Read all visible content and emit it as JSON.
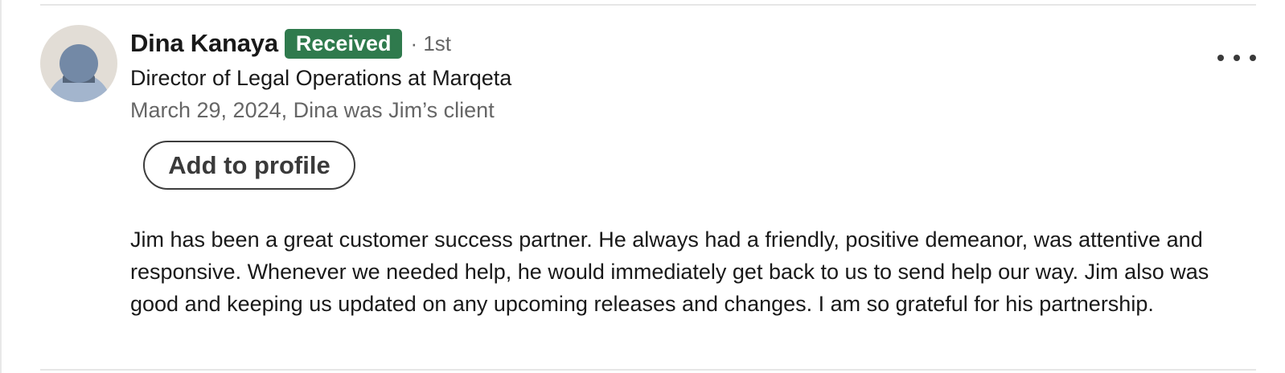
{
  "recommendation": {
    "author_name": "Dina Kanaya",
    "status_badge": "Received",
    "connection_degree": "· 1st",
    "headline": "Director of Legal Operations at Marqeta",
    "relationship": "March 29, 2024, Dina was Jim’s client",
    "add_button_label": "Add to profile",
    "more_icon": "more-horizontal-icon",
    "avatar_icon": "default-person-avatar",
    "text": "Jim has been a great customer success partner. He always had a friendly, positive demeanor, was attentive and responsive. Whenever we needed help, he would immediately get back to us to send help our way. Jim also was good and keeping us updated on any upcoming releases and changes. I am so grateful for his partnership."
  },
  "colors": {
    "badge_background": "#2f7a4d",
    "badge_text": "#ffffff",
    "primary_text": "#191919",
    "secondary_text": "#666666",
    "button_border": "#3d3d3d"
  }
}
